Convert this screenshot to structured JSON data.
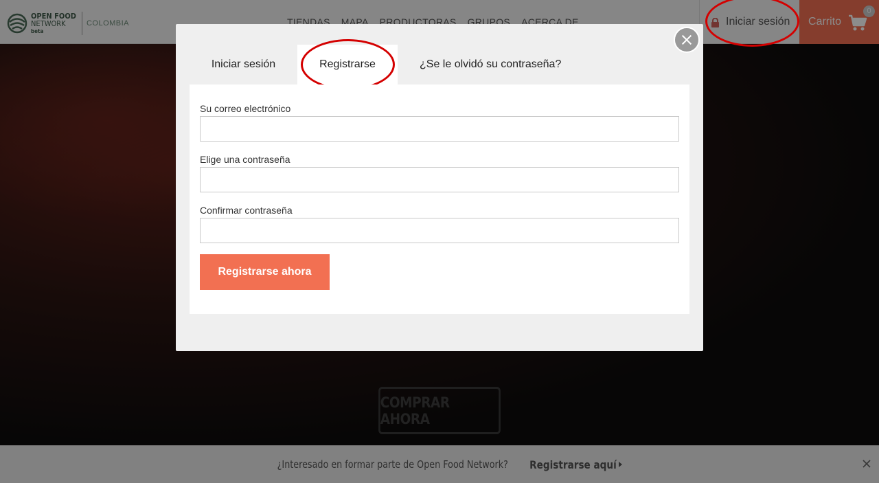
{
  "header": {
    "logo_line1": "OPEN FOOD",
    "logo_line2": "NETWORK",
    "logo_line3": "beta",
    "country": "COLOMBIA",
    "nav": [
      "TIENDAS",
      "MAPA",
      "PRODUCTORAS",
      "GRUPOS",
      "ACERCA DE"
    ],
    "login_label": "Iniciar sesión",
    "cart_label": "Carrito",
    "cart_count": "0"
  },
  "hero": {
    "cta_label": "COMPRAR AHORA"
  },
  "banner": {
    "text": "¿Interesado en formar parte de Open Food Network?",
    "link": "Registrarse aquí"
  },
  "modal": {
    "tabs": {
      "login": "Iniciar sesión",
      "register": "Registrarse",
      "forgot": "¿Se le olvidó su contraseña?"
    },
    "fields": {
      "email_label": "Su correo electrónico",
      "password_label": "Elige una contraseña",
      "confirm_label": "Confirmar contraseña"
    },
    "submit_label": "Registrarse ahora"
  },
  "colors": {
    "accent": "#f27052",
    "annotation": "#d40000"
  }
}
